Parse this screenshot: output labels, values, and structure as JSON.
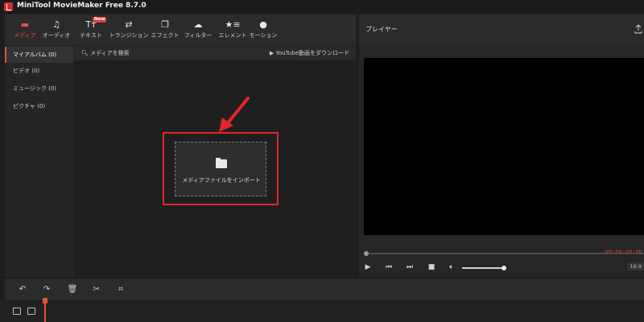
{
  "app": {
    "title": "MiniTool MovieMaker Free 8.7.0"
  },
  "toolbar": {
    "tools": [
      {
        "label": "メディア",
        "icon": "folder-icon",
        "active": true
      },
      {
        "label": "オーディオ",
        "icon": "music-note-icon"
      },
      {
        "label": "テキスト",
        "icon": "text-icon",
        "badge": "New"
      },
      {
        "label": "トランジション",
        "icon": "swap-arrows-icon"
      },
      {
        "label": "エフェクト",
        "icon": "effects-icon"
      },
      {
        "label": "フィルター",
        "icon": "filter-cloud-icon"
      },
      {
        "label": "エレメント",
        "icon": "element-star-icon"
      },
      {
        "label": "モーション",
        "icon": "motion-circle-icon"
      }
    ]
  },
  "sidebar": {
    "items": [
      {
        "label": "マイアルバム (0)",
        "active": true
      },
      {
        "label": "ビデオ (0)"
      },
      {
        "label": "ミュージック (0)"
      },
      {
        "label": "ピクチャ (0)"
      }
    ]
  },
  "media": {
    "search_label": "メディアを検索",
    "youtube_label": "YouTube動画をダウンロード",
    "import_label": "メディアファイルをインポート"
  },
  "player": {
    "title": "プレイヤー",
    "timecode": "00:00:00:00",
    "aspect_ratio": "16:9",
    "volume_level": 1.0,
    "progress": 0.0
  },
  "colors": {
    "accent": "#e0533f",
    "highlight_frame": "#e3262a",
    "background": "#1e1e1e"
  }
}
